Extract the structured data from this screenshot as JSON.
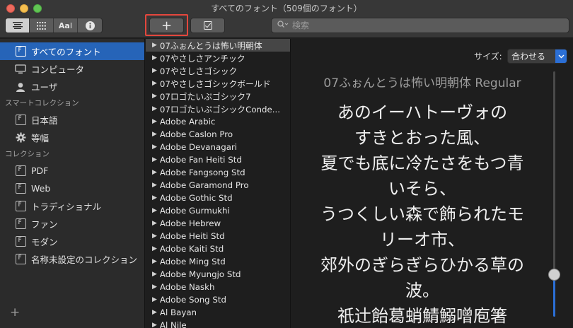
{
  "window": {
    "title": "すべてのフォント（509個のフォント）"
  },
  "toolbar": {
    "view_buttons": [
      {
        "name": "list-view",
        "label": ""
      },
      {
        "name": "grid-view",
        "label": ""
      },
      {
        "name": "sample-view",
        "label": "Aa"
      },
      {
        "name": "info-view",
        "label": "i"
      }
    ],
    "add_label": "+",
    "search_placeholder": "検索"
  },
  "sidebar": {
    "top_items": [
      {
        "label": "すべてのフォント",
        "icon": "font-collection-icon",
        "selected": true
      },
      {
        "label": "コンピュータ",
        "icon": "computer-icon",
        "selected": false
      },
      {
        "label": "ユーザ",
        "icon": "user-icon",
        "selected": false
      }
    ],
    "smart_header": "スマートコレクション",
    "smart_items": [
      {
        "label": "日本語",
        "icon": "font-collection-icon"
      },
      {
        "label": "等幅",
        "icon": "gear-icon"
      }
    ],
    "collections_header": "コレクション",
    "collection_items": [
      {
        "label": "PDF"
      },
      {
        "label": "Web"
      },
      {
        "label": "トラディショナル"
      },
      {
        "label": "ファン"
      },
      {
        "label": "モダン"
      },
      {
        "label": "名称未設定のコレクション"
      }
    ],
    "add_label": "+"
  },
  "font_list": [
    {
      "name": "07ふぉんとうは怖い明朝体",
      "selected": true
    },
    {
      "name": "07やさしさアンチック",
      "selected": false
    },
    {
      "name": "07やさしさゴシック",
      "selected": false
    },
    {
      "name": "07やさしさゴシックボールド",
      "selected": false
    },
    {
      "name": "07ロゴたいぷゴシック7",
      "selected": false
    },
    {
      "name": "07ロゴたいぷゴシックConde...",
      "selected": false
    },
    {
      "name": "Adobe Arabic",
      "selected": false
    },
    {
      "name": "Adobe Caslon Pro",
      "selected": false
    },
    {
      "name": "Adobe Devanagari",
      "selected": false
    },
    {
      "name": "Adobe Fan Heiti Std",
      "selected": false
    },
    {
      "name": "Adobe Fangsong Std",
      "selected": false
    },
    {
      "name": "Adobe Garamond Pro",
      "selected": false
    },
    {
      "name": "Adobe Gothic Std",
      "selected": false
    },
    {
      "name": "Adobe Gurmukhi",
      "selected": false
    },
    {
      "name": "Adobe Hebrew",
      "selected": false
    },
    {
      "name": "Adobe Heiti Std",
      "selected": false
    },
    {
      "name": "Adobe Kaiti Std",
      "selected": false
    },
    {
      "name": "Adobe Ming Std",
      "selected": false
    },
    {
      "name": "Adobe Myungjo Std",
      "selected": false
    },
    {
      "name": "Adobe Naskh",
      "selected": false
    },
    {
      "name": "Adobe Song Std",
      "selected": false
    },
    {
      "name": "Al Bayan",
      "selected": false
    },
    {
      "name": "Al Nile",
      "selected": false
    }
  ],
  "preview": {
    "size_label": "サイズ:",
    "size_value": "合わせる",
    "font_name": "07ふぉんとうは怖い明朝体 Regular",
    "sample_lines": [
      "あのイーハトーヴォの",
      "すきとおった風、",
      "夏でも底に冷たさをもつ青",
      "いそら、",
      "うつくしい森で飾られたモ",
      "リーオ市、",
      "郊外のぎらぎらひかる草の",
      "波。",
      "祇辻飴葛蛸鯖鰯噌庖箸"
    ],
    "slider_fraction": 0.19
  }
}
